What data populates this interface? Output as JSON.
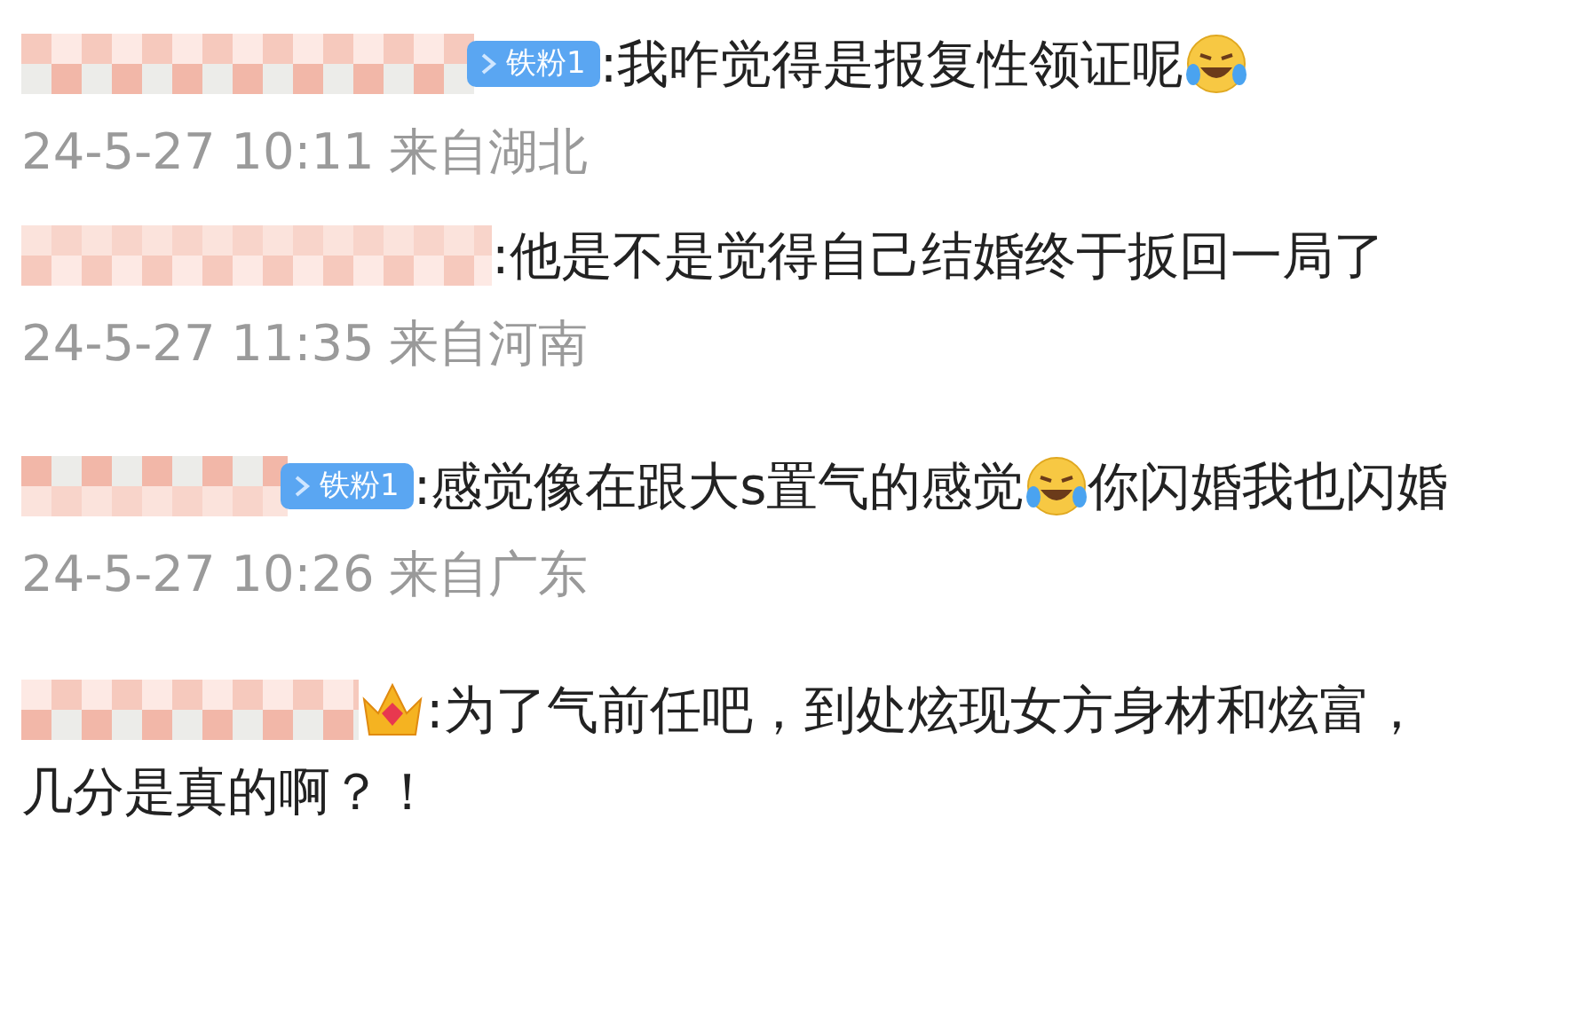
{
  "comments": [
    {
      "name_blurred": true,
      "badge": {
        "kind": "fan",
        "label": "铁粉1"
      },
      "parts": [
        {
          "kind": "text",
          "text": ":我咋觉得是报复性领证呢"
        },
        {
          "kind": "emoji"
        }
      ],
      "time": "24-5-27 10:11",
      "location": "来自湖北"
    },
    {
      "name_blurred": true,
      "parts": [
        {
          "kind": "text",
          "text": ":他是不是觉得自己结婚终于扳回一局了"
        }
      ],
      "time": "24-5-27 11:35",
      "location": "来自河南"
    },
    {
      "name_blurred": true,
      "badge": {
        "kind": "fan",
        "label": "铁粉1"
      },
      "parts": [
        {
          "kind": "text",
          "text": ":感觉像在跟大s置气的感觉"
        },
        {
          "kind": "emoji"
        },
        {
          "kind": "text",
          "text": "你闪婚我也闪婚"
        }
      ],
      "time": "24-5-27 10:26",
      "location": "来自广东"
    },
    {
      "name_blurred": true,
      "badge": {
        "kind": "crown"
      },
      "parts": [
        {
          "kind": "text",
          "text": ":为了气前任吧，到处炫现女方身材和炫富，"
        },
        {
          "kind": "break"
        },
        {
          "kind": "text",
          "text": "几分是真的啊？！"
        }
      ]
    }
  ]
}
